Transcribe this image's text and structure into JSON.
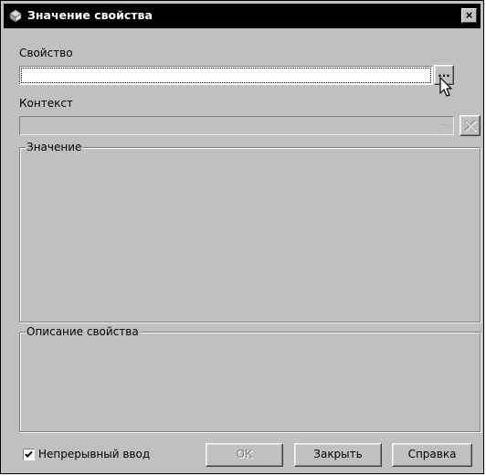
{
  "window": {
    "title": "Значение свойства",
    "close_glyph": "×"
  },
  "property": {
    "label": "Свойство",
    "value": "",
    "browse_label": "..."
  },
  "context": {
    "label": "Контекст",
    "value": "",
    "browse_label": "...",
    "clear_glyph": "✕"
  },
  "value_group": {
    "legend": "Значение"
  },
  "description_group": {
    "legend": "Описание свойства"
  },
  "footer": {
    "continuous_label": "Непрерывный ввод",
    "continuous_checked": true,
    "ok_label": "ОК",
    "close_label": "Закрыть",
    "help_label": "Справка"
  },
  "colors": {
    "titlebar": "#000000",
    "dialog_bg": "#c0c0c0",
    "disabled_text": "#808080"
  },
  "icons": {
    "title": "window-app-icon",
    "cursor": "mouse-pointer-icon",
    "clear": "clear-x-icon"
  }
}
